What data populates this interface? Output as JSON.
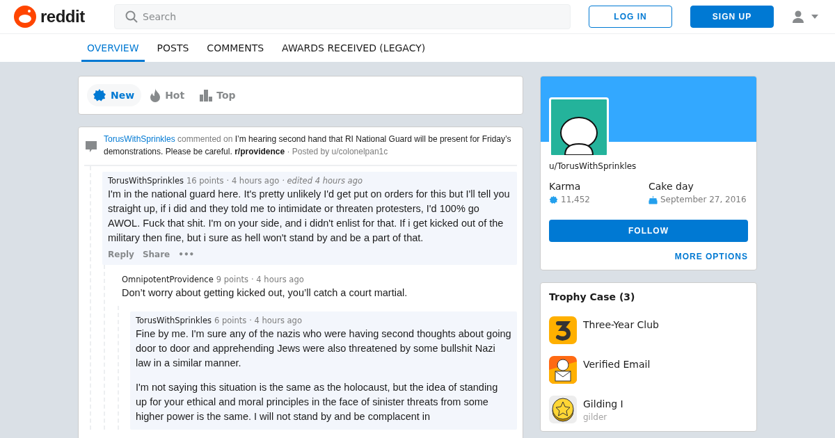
{
  "header": {
    "logo_text": "reddit",
    "search": {
      "placeholder": "Search"
    },
    "buttons": [
      {
        "label": "LOG IN",
        "kind": "outline"
      },
      {
        "label": "SIGN UP",
        "kind": "filled"
      }
    ]
  },
  "nav_tabs": [
    {
      "label": "OVERVIEW",
      "selected": true
    },
    {
      "label": "POSTS",
      "selected": false
    },
    {
      "label": "COMMENTS",
      "selected": false
    },
    {
      "label": "AWARDS RECEIVED (LEGACY)",
      "selected": false
    }
  ],
  "sort_tabs": [
    {
      "label": "New",
      "selected": true
    },
    {
      "label": "Hot",
      "selected": false
    },
    {
      "label": "Top",
      "selected": false
    }
  ],
  "post": {
    "author": "TorusWithSprinkles",
    "action": "commented on",
    "title": "I’m hearing second hand that RI National Guard will be present for Friday’s demonstrations. Please be careful.",
    "subreddit": "r/providence",
    "posted_by": "· Posted by u/colonelpan1c",
    "comments": [
      {
        "author": "TorusWithSprinkles",
        "points": "16 points",
        "time": "· 4 hours ago",
        "edited": "· edited 4 hours ago",
        "highlighted": true,
        "paragraphs": [
          "I'm in the national guard here. It's pretty unlikely I'd get put on orders for this but I'll tell you straight up, if i did and they told me to intimidate or threaten protesters, I'd 100% go AWOL. Fuck that shit. I'm on your side, and i didn't enlist for that. If i get kicked out of the military then fine, but i sure as hell won't stand by and be a part of that."
        ],
        "actions": [
          "Reply",
          "Share",
          "•••"
        ],
        "children": [
          {
            "author": "OmnipotentProvidence",
            "points": "9 points",
            "time": "· 4 hours ago",
            "highlighted": false,
            "paragraphs": [
              "Don’t worry about getting kicked out, you’ll catch a court martial."
            ],
            "children": [
              {
                "author": "TorusWithSprinkles",
                "points": "6 points",
                "time": "· 4 hours ago",
                "highlighted": true,
                "paragraphs": [
                  "Fine by me. I'm sure any of the nazis who were having second thoughts about going door to door and apprehending Jews were also threatened by some bullshit Nazi law in a similar manner.",
                  "I'm not saying this situation is the same as the holocaust, but the idea of standing up for your ethical and moral principles in the face of sinister threats from some higher power is the same. I will not stand by and be complacent in"
                ]
              }
            ]
          }
        ]
      }
    ]
  },
  "profile": {
    "username": "u/TorusWithSprinkles",
    "stats": [
      {
        "label": "Karma",
        "value": "11,452",
        "kind": "karma"
      },
      {
        "label": "Cake day",
        "value": "September 27, 2016",
        "kind": "cake"
      }
    ],
    "follow": "FOLLOW",
    "more": "MORE OPTIONS"
  },
  "trophy_case": {
    "title": "Trophy Case (3)",
    "trophies": [
      {
        "name": "Three-Year Club"
      },
      {
        "name": "Verified Email"
      },
      {
        "name": "Gilding I",
        "subtitle": "gilder"
      }
    ]
  }
}
